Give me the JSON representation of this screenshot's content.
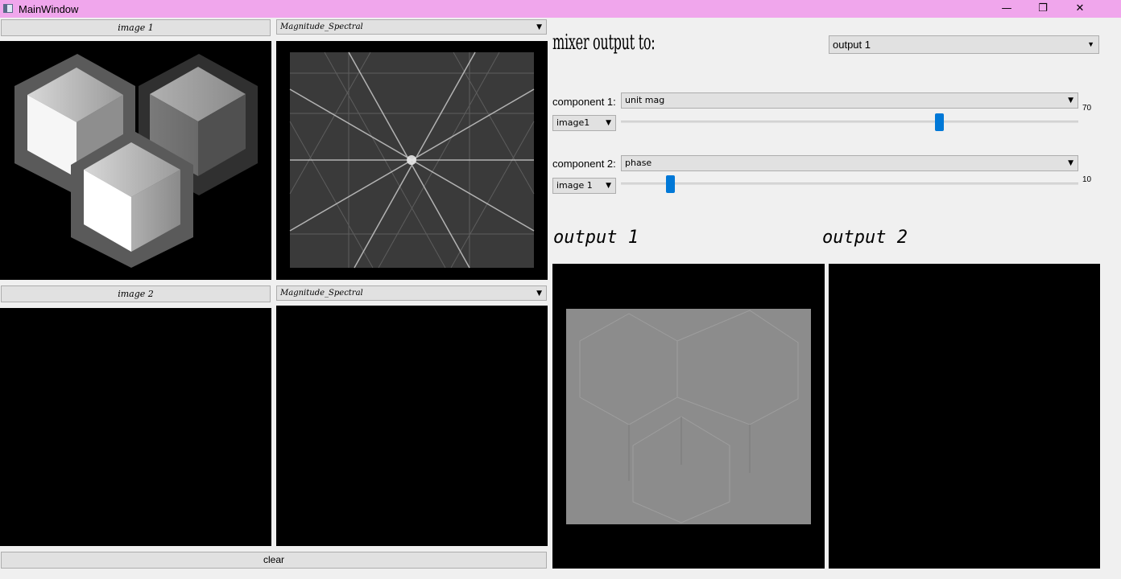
{
  "window": {
    "title": "MainWindow",
    "controls": {
      "minimize": "—",
      "maximize": "❐",
      "close": "✕"
    }
  },
  "image1": {
    "button_label": "image 1",
    "component_select": "Magnitude_Spectral"
  },
  "image2": {
    "button_label": "image 2",
    "component_select": "Magnitude_Spectral"
  },
  "clear_label": "clear",
  "mixer": {
    "heading": "mixer output to:",
    "output_select": "output 1",
    "component1": {
      "label": "component 1:",
      "type_select": "unit mag",
      "image_select": "image1",
      "slider_value": 70,
      "slider_value_text": "70"
    },
    "component2": {
      "label": "component 2:",
      "type_select": "phase",
      "image_select": "image 1",
      "slider_value": 10,
      "slider_value_text": "10"
    }
  },
  "outputs": {
    "output1_label": "output 1",
    "output2_label": "output 2"
  },
  "icons": {
    "dropdown": "▼"
  },
  "colors": {
    "titlebar": "#f0a6ec",
    "slider_handle": "#0078d7",
    "view_background": "#000000"
  }
}
